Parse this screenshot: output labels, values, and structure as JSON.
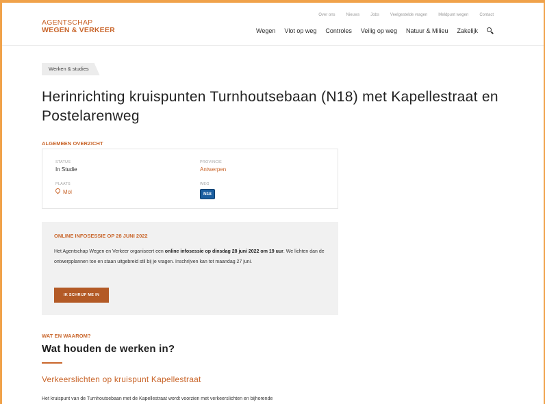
{
  "colors": {
    "accent": "#c9652a",
    "frame": "#f0a24a",
    "badge": "#1b5fa0",
    "button": "#b35a26"
  },
  "logo": {
    "line1": "Agentschap",
    "line2": "Wegen & Verkeer"
  },
  "topnav": [
    "Over ons",
    "Nieuws",
    "Jobs",
    "Veelgestelde vragen",
    "Meldpunt wegen",
    "Contact"
  ],
  "mainnav": [
    "Wegen",
    "Vlot op weg",
    "Controles",
    "Veilig op weg",
    "Natuur & Milieu",
    "Zakelijk"
  ],
  "breadcrumb": "Werken & studies",
  "title": "Herinrichting kruispunten Turnhoutsebaan (N18) met Kapellestraat en Postelarenweg",
  "overview": {
    "label": "Algemeen overzicht",
    "status_label": "Status",
    "status": "In Studie",
    "provincie_label": "Provincie",
    "provincie": "Antwerpen",
    "plaats_label": "Plaats",
    "plaats": "Mol",
    "weg_label": "Weg",
    "weg": "N18"
  },
  "info": {
    "title": "Online infosessie op 28 juni 2022",
    "text_1": "Het Agentschap Wegen en Verkeer organiseert een ",
    "text_bold": "online infosessie op dinsdag 28 juni 2022 om 19 uur",
    "text_2": ". We lichten dan de ontwerpplannen toe en staan uitgebreid stil bij je vragen. Inschrijven kan tot maandag 27 juni.",
    "button": "Ik schrijf me in"
  },
  "works": {
    "label": "Wat en waarom?",
    "heading": "Wat houden de werken in?",
    "subheading": "Verkeerslichten op kruispunt Kapellestraat",
    "paragraph": "Het kruispunt van de Turnhoutsebaan met de Kapellestraat wordt voorzien met verkeerslichten en bijhorende"
  }
}
